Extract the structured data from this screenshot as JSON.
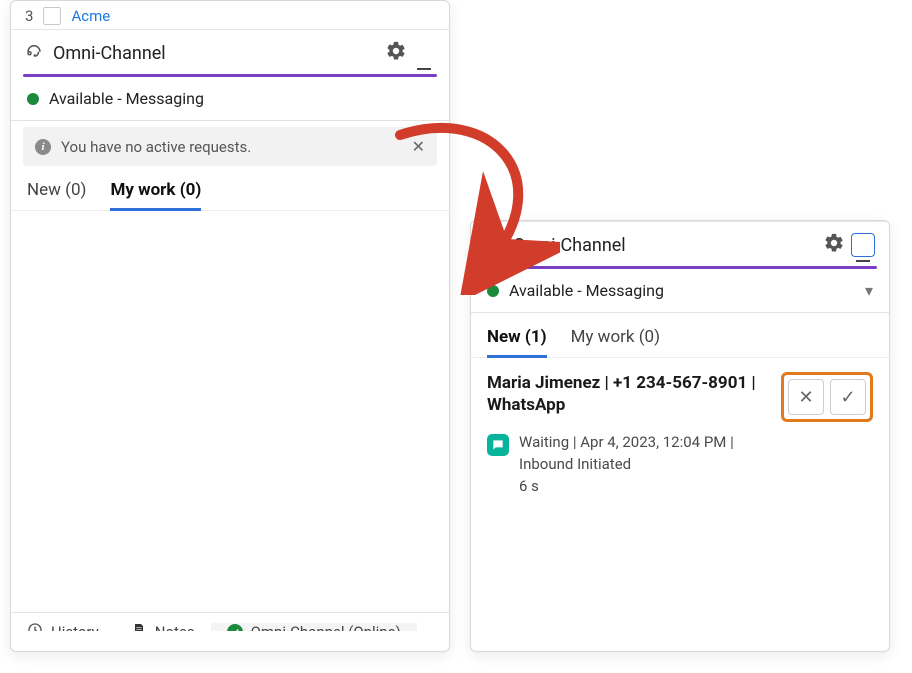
{
  "left": {
    "tab_index": "3",
    "tab_name": "Acme",
    "title": "Omni-Channel",
    "status": "Available - Messaging",
    "notice": "You have no active requests.",
    "tabs": {
      "new": "New (0)",
      "my_work": "My work (0)"
    },
    "bottom": {
      "history": "History",
      "notes": "Notes",
      "omni": "Omni-Channel (Online)"
    }
  },
  "right": {
    "title": "Omni-Channel",
    "status": "Available - Messaging",
    "tabs": {
      "new": "New (1)",
      "my_work": "My work (0)"
    },
    "request": {
      "header": "Maria Jimenez | +1 234-567-8901 | WhatsApp",
      "line1": "Waiting | Apr 4, 2023, 12:04 PM |",
      "line2": "Inbound Initiated",
      "line3": "6 s"
    }
  }
}
